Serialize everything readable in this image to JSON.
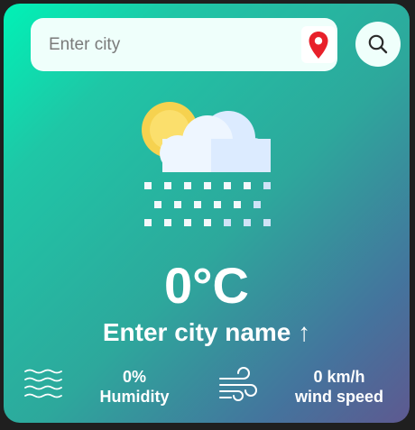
{
  "search": {
    "placeholder": "Enter city",
    "value": ""
  },
  "icons": {
    "location": "location-pin-icon",
    "search": "search-icon",
    "weather": "sun-cloud-snow-icon",
    "humidity": "humidity-waves-icon",
    "wind": "wind-icon"
  },
  "weather": {
    "temperature": "0°C",
    "city": "Enter city name ↑"
  },
  "stats": {
    "humidity_value": "0%",
    "humidity_label": "Humidity",
    "wind_value": "0 km/h",
    "wind_label": "wind speed"
  },
  "colors": {
    "gradient_start": "#00f2b6",
    "gradient_end": "#5e5990",
    "pin_red": "#e8202a",
    "text": "#ffffff"
  }
}
